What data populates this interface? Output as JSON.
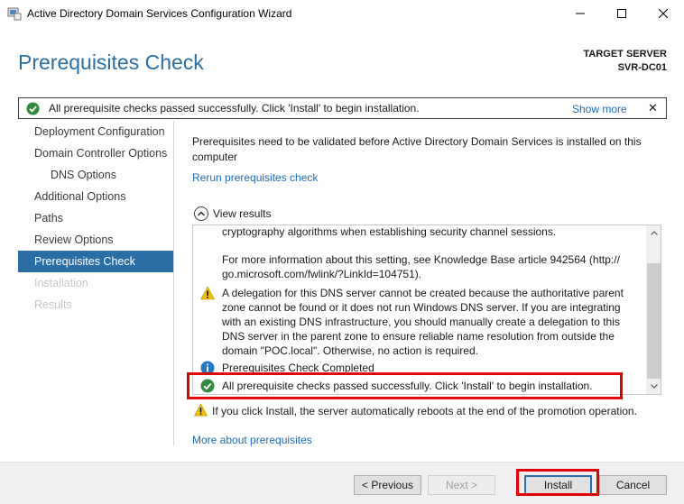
{
  "window": {
    "title": "Active Directory Domain Services Configuration Wizard"
  },
  "header": {
    "page_title": "Prerequisites Check",
    "target_label": "TARGET SERVER",
    "target_name": "SVR-DC01"
  },
  "notification": {
    "message": "All prerequisite checks passed successfully.  Click 'Install' to begin installation.",
    "show_more": "Show more",
    "close": "✕"
  },
  "nav": {
    "items": [
      {
        "label": "Deployment Configuration",
        "state": "normal"
      },
      {
        "label": "Domain Controller Options",
        "state": "normal"
      },
      {
        "label": "DNS Options",
        "state": "sub"
      },
      {
        "label": "Additional Options",
        "state": "normal"
      },
      {
        "label": "Paths",
        "state": "normal"
      },
      {
        "label": "Review Options",
        "state": "normal"
      },
      {
        "label": "Prerequisites Check",
        "state": "active"
      },
      {
        "label": "Installation",
        "state": "disabled"
      },
      {
        "label": "Results",
        "state": "disabled"
      }
    ]
  },
  "content": {
    "intro": "Prerequisites need to be validated before Active Directory Domain Services is installed on this computer",
    "rerun": "Rerun prerequisites check",
    "view_results": "View results",
    "results": {
      "line_crypto": "cryptography algorithms when establishing security channel sessions.",
      "kb_line1": "For more information about this setting, see Knowledge Base article 942564 (http://",
      "kb_line2": "go.microsoft.com/fwlink/?LinkId=104751).",
      "dns_warning": [
        "A delegation for this DNS server cannot be created because the authoritative parent",
        "zone cannot be found or it does not run Windows DNS server. If you are integrating",
        "with an existing DNS infrastructure, you should manually create a delegation to this",
        "DNS server in the parent zone to ensure reliable name resolution from outside the",
        "domain \"POC.local\". Otherwise, no action is required."
      ],
      "completed": "Prerequisites Check Completed",
      "passed": "All prerequisite checks passed successfully.  Click 'Install' to begin installation."
    },
    "reboot_warning": "If you click Install, the server automatically reboots at the end of the promotion operation.",
    "more_link": "More about prerequisites"
  },
  "footer": {
    "previous": "< Previous",
    "next": "Next >",
    "install": "Install",
    "cancel": "Cancel"
  },
  "colors": {
    "accent": "#2b6ea6",
    "link": "#1e6bb8",
    "success": "#2e8b3e",
    "warning": "#f2c200",
    "highlight": "#e00000"
  }
}
